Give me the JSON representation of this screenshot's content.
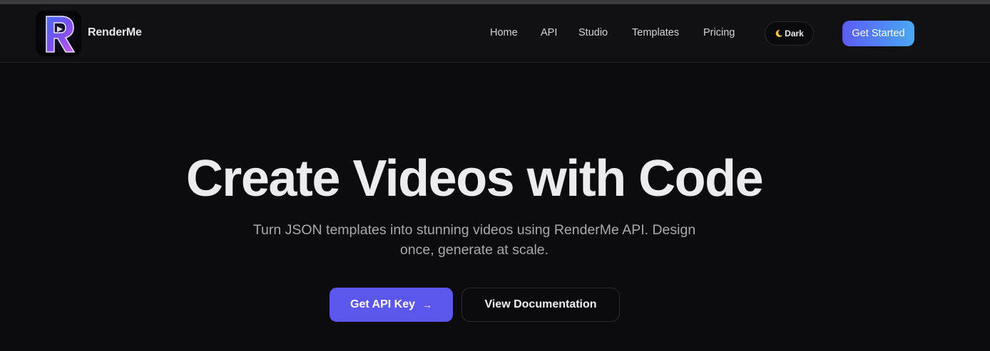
{
  "brand": {
    "name": "RenderMe",
    "logo_letter": "R",
    "accent": "#5b57ec"
  },
  "nav": {
    "links": [
      "Home",
      "API",
      "Studio",
      "Templates",
      "Pricing"
    ],
    "theme_toggle": {
      "icon": "moon-icon",
      "label": "Dark"
    },
    "cta_label": "Get Started"
  },
  "hero": {
    "title": "Create Videos with Code",
    "subtitle_line1": "Turn JSON templates into stunning videos using RenderMe API. Design",
    "subtitle_line2": "once, generate at scale.",
    "primary_button": {
      "label": "Get API Key",
      "icon": "arrow-right-icon",
      "arrow": "→"
    },
    "secondary_button": {
      "label": "View Documentation"
    }
  }
}
